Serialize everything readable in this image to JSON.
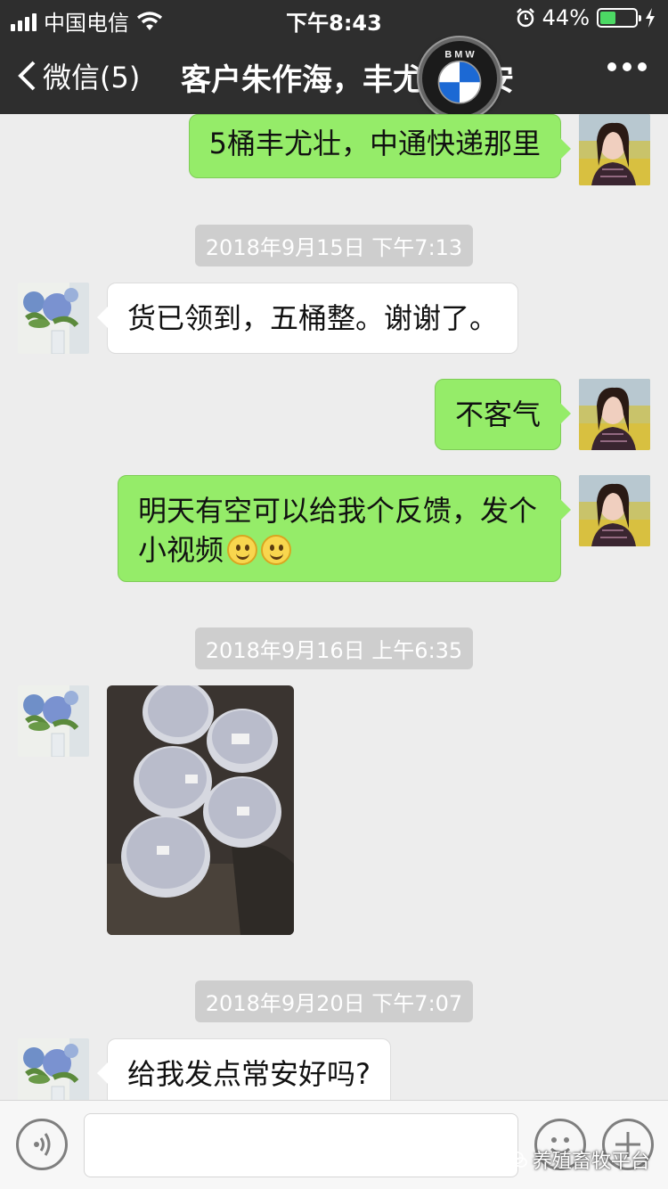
{
  "status_bar": {
    "carrier": "中国电信",
    "time": "下午8:43",
    "battery_percent": "44%",
    "battery_level": 0.44
  },
  "nav": {
    "back_label": "微信(5)",
    "title": "客户朱作海，丰尤壮常安"
  },
  "messages": [
    {
      "sender": "me",
      "text": "5桶丰尤壮，中通快递那里"
    },
    {
      "timestamp": "2018年9月15日 下午7:13"
    },
    {
      "sender": "them",
      "text": "货已领到，五桶整。谢谢了。"
    },
    {
      "sender": "me",
      "text": "不客气"
    },
    {
      "sender": "me",
      "text_line1": "明天有空可以给我个反馈，发个",
      "text_line2": "小视频",
      "emoji": "smile-emoji"
    },
    {
      "timestamp": "2018年9月16日 上午6:35"
    },
    {
      "sender": "them",
      "type": "image"
    },
    {
      "timestamp": "2018年9月20日 下午7:07"
    },
    {
      "sender": "them",
      "text": "给我发点常安好吗?"
    }
  ],
  "watermark": "养殖畜牧平台",
  "colors": {
    "header": "#2e2e2e",
    "my_bubble": "#95ec69",
    "their_bubble": "#ffffff",
    "chat_bg": "#ededed"
  },
  "icons": {
    "back": "chevron-left-icon",
    "more": "ellipsis-icon",
    "voice": "voice-icon",
    "emoji": "emoji-icon",
    "plus": "plus-icon"
  }
}
